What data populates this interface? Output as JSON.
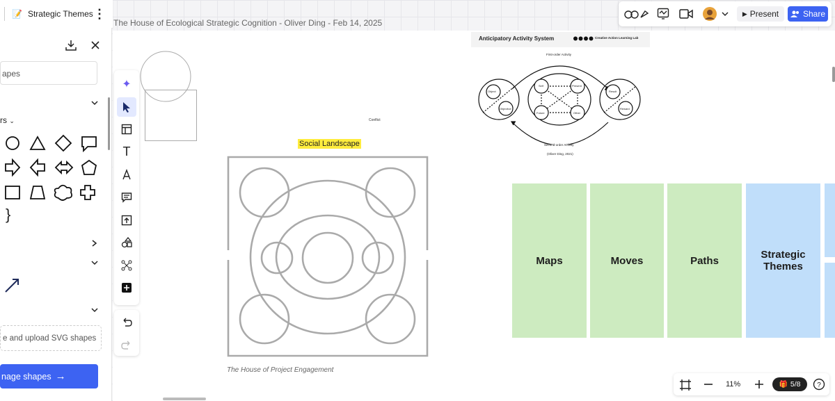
{
  "header": {
    "board_title": "Strategic Themes",
    "board_emoji": "📝",
    "breadcrumb": "The House of Ecological Strategic Cognition - Oliver Ding - Feb 14, 2025",
    "present_label": "Present",
    "share_label": "Share"
  },
  "shapes_panel": {
    "search_placeholder": "apes",
    "section_label": "rs",
    "upload_text": "e and upload SVG shapes",
    "manage_label": "nage shapes"
  },
  "canvas": {
    "social_landscape": "Social Landscape",
    "house_caption": "The House of Project Engagement",
    "conflict_label": "Conflict",
    "aas": {
      "title": "Anticipatory Activity System",
      "lab": "Creative Action Learning Lab",
      "first_order": "First-order Activity",
      "second_order": "Second-order Activity",
      "citation": "(Oliver Ding, 2021)",
      "nodes": [
        "Object",
        "Objective",
        "Self",
        "Present",
        "Future",
        "Other",
        "Result",
        "Reward"
      ]
    },
    "stickies": [
      "Maps",
      "Moves",
      "Paths",
      "Strategic Themes"
    ]
  },
  "zoom": {
    "level": "11%",
    "pages": "5/8"
  },
  "colors": {
    "accent": "#3d63f2",
    "sticky_green": "#cdebc0",
    "sticky_blue": "#c0defa",
    "highlight": "#ffec3d"
  }
}
